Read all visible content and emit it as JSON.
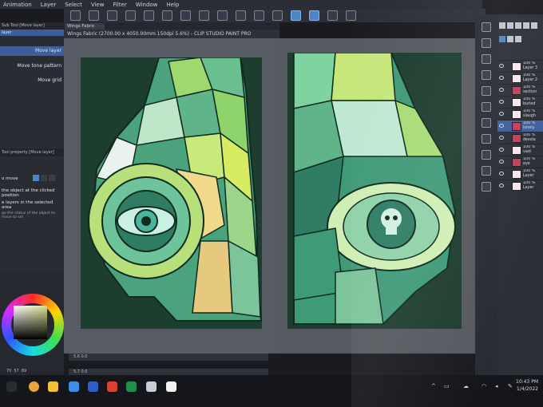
{
  "menu": {
    "items": [
      "Animation",
      "Layer",
      "Select",
      "View",
      "Filter",
      "Window",
      "Help"
    ]
  },
  "left_panel": {
    "sub_tool_label": "Sub Tool [Move layer]",
    "category_label": "layer",
    "tools": [
      "Move layer",
      "Move tone pattern",
      "Move grid"
    ],
    "active_tool_index": 0,
    "tool_property_label": "Tool property [Move layer]",
    "properties": [
      "o move",
      "the object at the clicked position",
      "e layers in the selected area",
      "ge the status of the object to move to sel"
    ],
    "color_readout": [
      "70",
      "57",
      "89"
    ]
  },
  "canvas": {
    "tab_label": "Wings Fabric",
    "window_title": "Wings Fabric (2700.00 x 4050.00mm 150dpi 5.6%) - CLIP STUDIO PAINT PRO",
    "zoom_readout_1": "5.6  0.0",
    "zoom_readout_2": "5.7  0.0"
  },
  "layers": [
    {
      "opacity": "100 %",
      "name": "Layer 3",
      "selected": false
    },
    {
      "opacity": "100 %",
      "name": "Layer 2",
      "selected": false
    },
    {
      "opacity": "100 %",
      "name": "section",
      "selected": false
    },
    {
      "opacity": "100 %",
      "name": "buried",
      "selected": false
    },
    {
      "opacity": "100 %",
      "name": "slaugh",
      "selected": false
    },
    {
      "opacity": "100 %",
      "name": "lonely",
      "selected": true
    },
    {
      "opacity": "100 %",
      "name": "desola",
      "selected": false
    },
    {
      "opacity": "100 %",
      "name": "vast",
      "selected": false
    },
    {
      "opacity": "100 %",
      "name": "eye",
      "selected": false
    },
    {
      "opacity": "100 %",
      "name": "Layer",
      "selected": false
    },
    {
      "opacity": "100 %",
      "name": "Layer",
      "selected": false
    }
  ],
  "taskbar": {
    "time": "10:43 PM",
    "date": "1/4/2022"
  },
  "colors": {
    "selection": "#3f5f9c",
    "canvas_bg": "#1d3d2f",
    "accent_green": "#8fd46b"
  }
}
